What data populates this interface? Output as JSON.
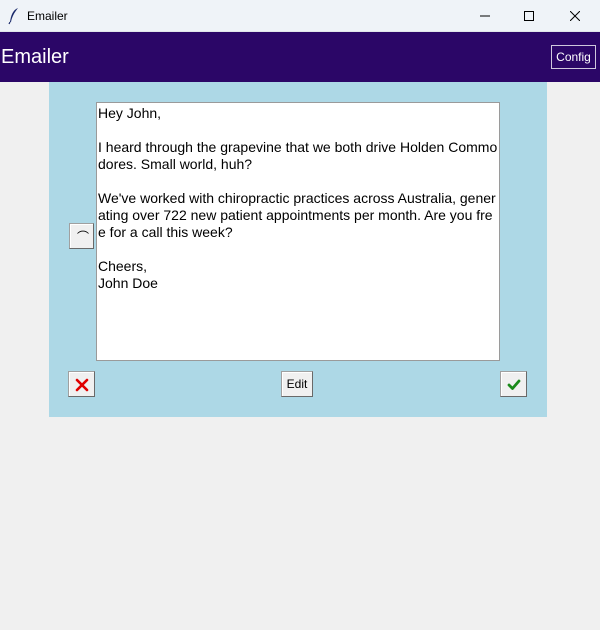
{
  "window": {
    "title": "Emailer"
  },
  "header": {
    "title": "Emailer",
    "config_label": "Config"
  },
  "email": {
    "body": "Hey John,\n\nI heard through the grapevine that we both drive Holden Commodores. Small world, huh?\n\nWe've worked with chiropractic practices across Australia, generating over 722 new patient appointments per month. Are you free for a call this week?\n\nCheers,\nJohn Doe"
  },
  "actions": {
    "collapse_icon": "caret-up-icon",
    "reject_icon": "x-icon",
    "edit_label": "Edit",
    "approve_icon": "check-icon"
  },
  "colors": {
    "header_bg": "#2b0667",
    "panel_bg": "#add8e6",
    "reject": "#e00000",
    "approve": "#1a8a1a"
  }
}
